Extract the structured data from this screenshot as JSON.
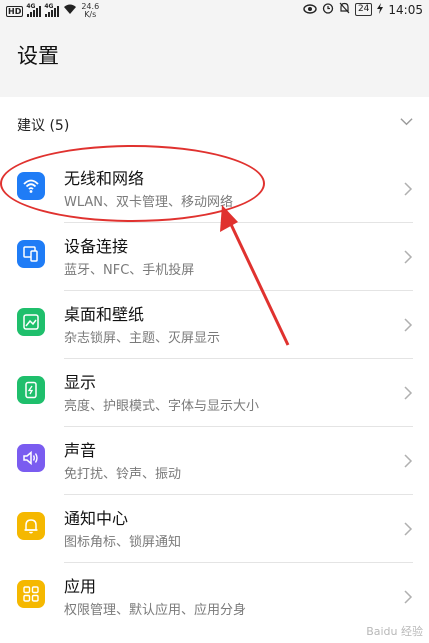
{
  "status_bar": {
    "left": {
      "hd_label": "HD",
      "signal1_tag": "4G",
      "signal2_tag": "4G",
      "speed_value": "24.6",
      "speed_unit": "K/s"
    },
    "right": {
      "battery": "24",
      "time": "14:05"
    }
  },
  "page": {
    "title": "设置"
  },
  "suggestions": {
    "label": "建议 (5)"
  },
  "settings_items": [
    {
      "title": "无线和网络",
      "subtitle": "WLAN、双卡管理、移动网络",
      "icon": "wifi-icon",
      "color": "#1f7cf6"
    },
    {
      "title": "设备连接",
      "subtitle": "蓝牙、NFC、手机投屏",
      "icon": "device-connection-icon",
      "color": "#1f7cf6"
    },
    {
      "title": "桌面和壁纸",
      "subtitle": "杂志锁屏、主题、灭屏显示",
      "icon": "wallpaper-icon",
      "color": "#1fbf6c"
    },
    {
      "title": "显示",
      "subtitle": "亮度、护眼模式、字体与显示大小",
      "icon": "display-icon",
      "color": "#1fbf6c"
    },
    {
      "title": "声音",
      "subtitle": "免打扰、铃声、振动",
      "icon": "sound-icon",
      "color": "#7a5cf0"
    },
    {
      "title": "通知中心",
      "subtitle": "图标角标、锁屏通知",
      "icon": "notification-icon",
      "color": "#f5b800"
    },
    {
      "title": "应用",
      "subtitle": "权限管理、默认应用、应用分身",
      "icon": "apps-icon",
      "color": "#f5b800"
    }
  ],
  "watermark": "Baidu 经验"
}
